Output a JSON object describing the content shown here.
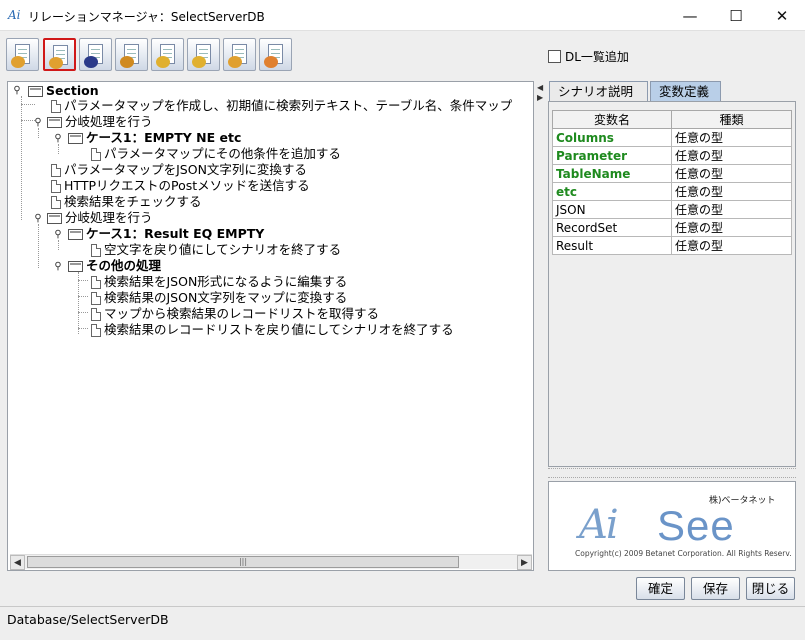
{
  "window": {
    "logo_text": "Ai",
    "title": "リレーションマネージャ：SelectServerDB",
    "min_glyph": "—",
    "max_glyph": "☐",
    "close_glyph": "✕"
  },
  "toolbar": {
    "buttons": [
      {
        "icon": "doc-edit-icon"
      },
      {
        "icon": "doc-settings-icon"
      },
      {
        "icon": "doc-pencil-icon"
      },
      {
        "icon": "doc-tools-icon"
      },
      {
        "icon": "doc-rotate-icon"
      },
      {
        "icon": "doc-wrench-icon"
      },
      {
        "icon": "doc-list-icon"
      },
      {
        "icon": "doc-bookmark-icon"
      }
    ],
    "dl_checkbox_label": "DL一覧追加"
  },
  "tree": {
    "rows": [
      {
        "label": "Section",
        "bold": true
      },
      {
        "label": "パラメータマップを作成し、初期値に検索列テキスト、テーブル名、条件マップ"
      },
      {
        "label": "分岐処理を行う"
      },
      {
        "label": "ケース1：EMPTY NE etc",
        "bold": true
      },
      {
        "label": "パラメータマップにその他条件を追加する"
      },
      {
        "label": "パラメータマップをJSON文字列に変換する"
      },
      {
        "label": "HTTPリクエストのPostメソッドを送信する"
      },
      {
        "label": "検索結果をチェックする"
      },
      {
        "label": "分岐処理を行う"
      },
      {
        "label": "ケース1：Result EQ EMPTY",
        "bold": true
      },
      {
        "label": "空文字を戻り値にしてシナリオを終了する"
      },
      {
        "label": "その他の処理",
        "bold": true
      },
      {
        "label": "検索結果をJSON形式になるように編集する"
      },
      {
        "label": "検索結果のJSON文字列をマップに変換する"
      },
      {
        "label": "マップから検索結果のレコードリストを取得する"
      },
      {
        "label": "検索結果のレコードリストを戻り値にしてシナリオを終了する"
      }
    ],
    "scroll_left": "◀",
    "scroll_right": "▶",
    "scroll_grip": "|||",
    "toggle_glyph": "⚲"
  },
  "splitter": {
    "left_arrow": "◀",
    "right_arrow": "▶"
  },
  "tabs": [
    {
      "label": "シナリオ説明",
      "active": false
    },
    {
      "label": "変数定義",
      "active": true
    }
  ],
  "vars": {
    "headers": [
      "変数名",
      "種類"
    ],
    "rows": [
      {
        "name": "Columns",
        "type": "任意の型",
        "highlight": true
      },
      {
        "name": "Parameter",
        "type": "任意の型",
        "highlight": true
      },
      {
        "name": "TableName",
        "type": "任意の型",
        "highlight": true
      },
      {
        "name": "etc",
        "type": "任意の型",
        "highlight": true
      },
      {
        "name": "JSON",
        "type": "任意の型",
        "highlight": false
      },
      {
        "name": "RecordSet",
        "type": "任意の型",
        "highlight": false
      },
      {
        "name": "Result",
        "type": "任意の型",
        "highlight": false
      }
    ]
  },
  "brand": {
    "company": "株)ベータネット",
    "ai": "Ai",
    "see": "See",
    "copyright": "Copyright(c) 2009 Betanet Corporation. All Rights Reserv."
  },
  "buttons": {
    "confirm": "確定",
    "save": "保存",
    "close": "閉じる"
  },
  "status": "Database/SelectServerDB",
  "colors": {
    "accent_tab": "#b9cfe8",
    "var_highlight": "#1e8a1e",
    "selected_border": "#d01818"
  }
}
